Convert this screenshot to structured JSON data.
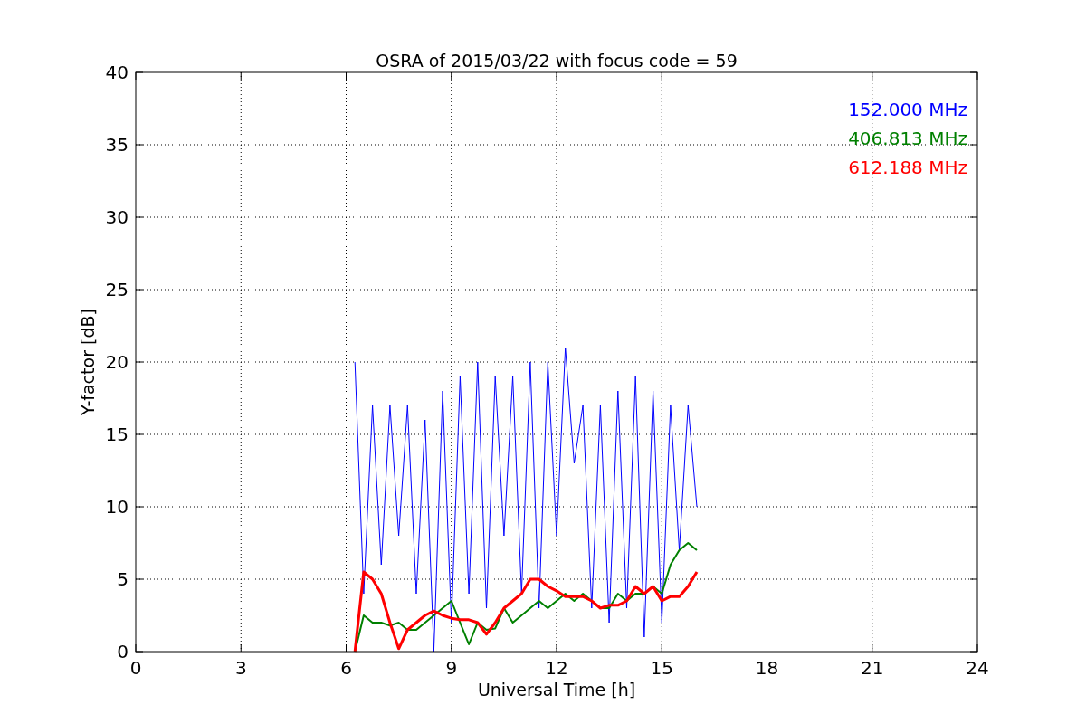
{
  "figure": {
    "chart_data": {
      "type": "line",
      "title": "OSRA of 2015/03/22 with focus code = 59",
      "xlabel": "Universal Time [h]",
      "ylabel": "Y-factor [dB]",
      "x": [
        6.25,
        6.5,
        6.75,
        7.0,
        7.25,
        7.5,
        7.75,
        8.0,
        8.25,
        8.5,
        8.75,
        9.0,
        9.25,
        9.5,
        9.75,
        10.0,
        10.25,
        10.5,
        10.75,
        11.0,
        11.25,
        11.5,
        11.75,
        12.0,
        12.25,
        12.5,
        12.75,
        13.0,
        13.25,
        13.5,
        13.75,
        14.0,
        14.25,
        14.5,
        14.75,
        15.0,
        15.25,
        15.5,
        15.75,
        16.0
      ],
      "series": [
        {
          "name": "152.000 MHz",
          "color": "#0000ff",
          "values": [
            20,
            4,
            17,
            6,
            17,
            8,
            17,
            4,
            16,
            0,
            18,
            2,
            19,
            4,
            20,
            3,
            19,
            8,
            19,
            4,
            20,
            3,
            20,
            8,
            21,
            13,
            17,
            3,
            17,
            2,
            18,
            3,
            19,
            1,
            18,
            2,
            17,
            7,
            17,
            10
          ]
        },
        {
          "name": "406.813 MHz",
          "color": "#008000",
          "values": [
            0,
            2.5,
            2,
            2,
            1.8,
            2,
            1.5,
            1.5,
            2,
            2.5,
            3,
            3.5,
            2,
            0.5,
            2,
            1.5,
            1.6,
            3,
            2,
            2.5,
            3,
            3.5,
            3,
            3.5,
            4,
            3.5,
            4,
            3.5,
            3,
            3,
            4,
            3.5,
            4,
            4,
            4.5,
            4,
            6,
            7,
            7.5,
            7
          ]
        },
        {
          "name": "612.188 MHz",
          "color": "#ff0000",
          "values": [
            0,
            5.5,
            5,
            4,
            2,
            0.2,
            1.5,
            2,
            2.5,
            2.8,
            2.5,
            2.3,
            2.2,
            2.2,
            2,
            1.2,
            2,
            3,
            3.5,
            4,
            5,
            5,
            4.5,
            4.2,
            3.8,
            3.8,
            3.8,
            3.5,
            3,
            3.2,
            3.2,
            3.5,
            4.5,
            4,
            4.5,
            3.5,
            3.8,
            3.8,
            4.5,
            5.5
          ]
        }
      ],
      "xlim": [
        0,
        24
      ],
      "ylim": [
        0,
        40
      ],
      "xticks": [
        0,
        3,
        6,
        9,
        12,
        15,
        18,
        21,
        24
      ],
      "yticks": [
        0,
        5,
        10,
        15,
        20,
        25,
        30,
        35,
        40
      ],
      "grid": true
    }
  }
}
